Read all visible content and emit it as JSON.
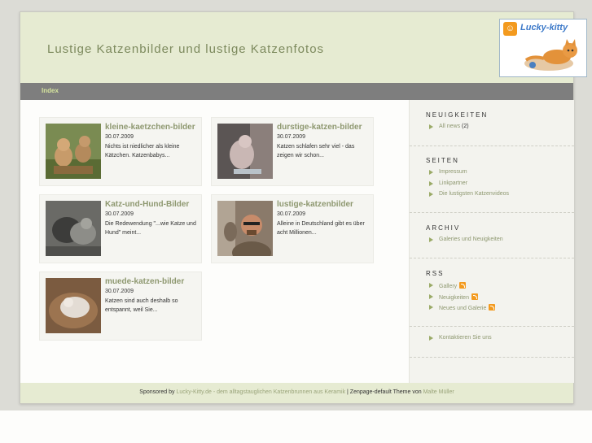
{
  "header": {
    "site_title": "Lustige Katzenbilder und lustige Katzenfotos",
    "logo_text": "Lucky-kitty"
  },
  "nav": {
    "index_label": "Index"
  },
  "posts": [
    {
      "title": "kleine-kaetzchen-bilder",
      "date": "30.07.2009",
      "excerpt": "Nichts ist niedlicher als kleine Kätzchen. Katzenbabys..."
    },
    {
      "title": "durstige-katzen-bilder",
      "date": "30.07.2009",
      "excerpt": "Katzen schlafen sehr viel - das zeigen wir schon..."
    },
    {
      "title": "Katz-und-Hund-Bilder",
      "date": "30.07.2009",
      "excerpt": "Die Redewendung \"...wie Katze und Hund\" meint..."
    },
    {
      "title": "lustige-katzenbilder",
      "date": "30.07.2009",
      "excerpt": "Alleine in Deutschland gibt es über acht Millionen..."
    },
    {
      "title": "muede-katzen-bilder",
      "date": "30.07.2009",
      "excerpt": "Katzen sind auch deshalb so entspannt, weil Sie..."
    }
  ],
  "sidebar": {
    "news": {
      "heading": "NEUIGKEITEN",
      "items": [
        {
          "label": "All news",
          "count": "(2)"
        }
      ]
    },
    "pages": {
      "heading": "SEITEN",
      "items": [
        "Impressum",
        "Linkpartner",
        "Die lustigsten Katzenvideos"
      ]
    },
    "archive": {
      "heading": "ARCHIV",
      "items": [
        "Galeries und Neuigkeiten"
      ]
    },
    "rss": {
      "heading": "RSS",
      "items": [
        "Gallery",
        "Neuigkeiten",
        "Neues und Galerie"
      ]
    },
    "contact": {
      "items": [
        "Kontaktieren Sie uns"
      ]
    }
  },
  "footer": {
    "prefix": "Sponsored by ",
    "sponsor_link": "Lucky-Kitty.de - dem alltagstauglichen Katzenbrunnen aus Keramik",
    "middle": " | Zenpage-default Theme von ",
    "author_link": "Malte Müller"
  },
  "colors": {
    "header_bg": "#e6ebd2",
    "navbar_bg": "#7e7e7e",
    "accent": "#8e9870",
    "rss_orange": "#f39a1e"
  }
}
